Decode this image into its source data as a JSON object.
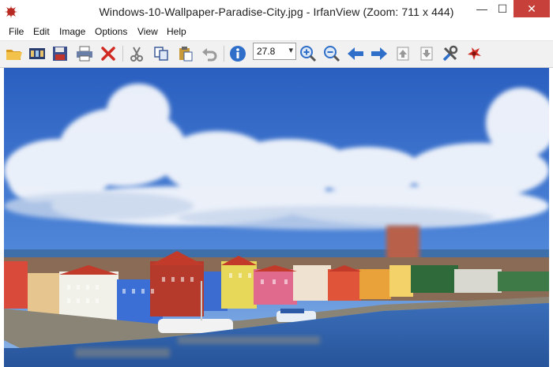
{
  "window": {
    "title": "Windows-10-Wallpaper-Paradise-City.jpg - IrfanView (Zoom: 711 x 444)",
    "controls": {
      "minimize": "—",
      "maximize": "☐",
      "close": "✕"
    }
  },
  "menu": {
    "items": [
      "File",
      "Edit",
      "Image",
      "Options",
      "View",
      "Help"
    ]
  },
  "toolbar": {
    "icons": [
      "open-folder-icon",
      "thumbnails-icon",
      "save-icon",
      "print-icon",
      "delete-icon",
      "cut-icon",
      "copy-icon",
      "paste-icon",
      "undo-icon",
      "info-icon",
      "zoom-in-icon",
      "zoom-out-icon",
      "previous-icon",
      "next-icon",
      "first-page-icon",
      "next-page-icon",
      "settings-icon",
      "irfanview-logo-icon"
    ],
    "zoom_value": "27.8"
  },
  "image": {
    "subject": "Willemstad harbor colorful buildings under blue sky with clouds"
  },
  "colors": {
    "close_button": "#c7413a",
    "toolbar_bg": "#f1f1f1",
    "sky": "#2f66c4",
    "water": "#2b5fa8"
  }
}
